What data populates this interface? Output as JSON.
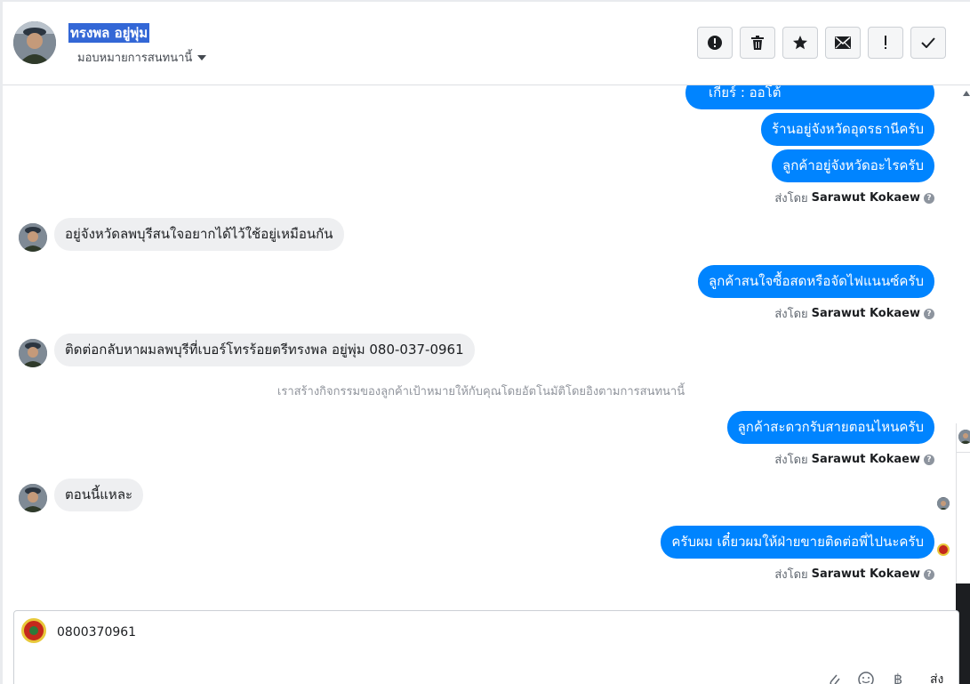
{
  "header": {
    "customer_name": "ทรงพล อยู่พุ่ม",
    "assign_label": "มอบหมายการสนทนานี้"
  },
  "toolbar": {
    "buttons": [
      {
        "icon": "alert-circle-icon",
        "glyph": "!"
      },
      {
        "icon": "trash-icon"
      },
      {
        "icon": "star-icon",
        "glyph": "★"
      },
      {
        "icon": "envelope-icon"
      },
      {
        "icon": "exclamation-icon",
        "glyph": "!"
      },
      {
        "icon": "checkmark-icon",
        "glyph": "✓"
      }
    ]
  },
  "messages": [
    {
      "direction": "out",
      "text": "เกียร์ : ออโต้"
    },
    {
      "direction": "out",
      "text": "ร้านอยู่จังหวัดอุดรธานีครับ"
    },
    {
      "direction": "out",
      "text": "ลูกค้าอยู่จังหวัดอะไรครับ"
    },
    {
      "direction": "in",
      "text": "อยู่จังหวัดลพบุรีสนใจอยากได้ไว้ใช้อยู่เหมือนกัน"
    },
    {
      "direction": "out",
      "text": "ลูกค้าสนใจซื้อสดหรือจัดไฟแนนซ์ครับ"
    },
    {
      "direction": "in",
      "text": "ติดต่อกลับหาผมลพบุรีที่เบอร์โทรร้อยตรีทรงพล อยู่พุ่ม  080-037-0961"
    },
    {
      "direction": "out",
      "text": "ลูกค้าสะดวกรับสายตอนไหนครับ"
    },
    {
      "direction": "in",
      "text": "ตอนนี้แหละ"
    },
    {
      "direction": "out",
      "text": "ครับผม เดี๋ยวผมให้ฝ่ายขายติดต่อพี่ไปนะครับ"
    }
  ],
  "sent_by": {
    "prefix": "ส่งโดย",
    "agent": "Sarawut Kokaew",
    "help_glyph": "?"
  },
  "system_note": "เราสร้างกิจกรรมของลูกค้าเป้าหมายให้กับคุณโดยอัตโนมัติโดยอิงตามการสนทนานี้",
  "composer": {
    "value": "0800370961",
    "icons": [
      "paperclip-icon",
      "smiley-icon",
      "baht-icon"
    ],
    "baht_glyph": "฿",
    "send_label": "ส่ง"
  },
  "colors": {
    "outgoing_bubble": "#0084ff",
    "incoming_bubble": "#eeeff1",
    "name_highlight": "#3367d6"
  }
}
